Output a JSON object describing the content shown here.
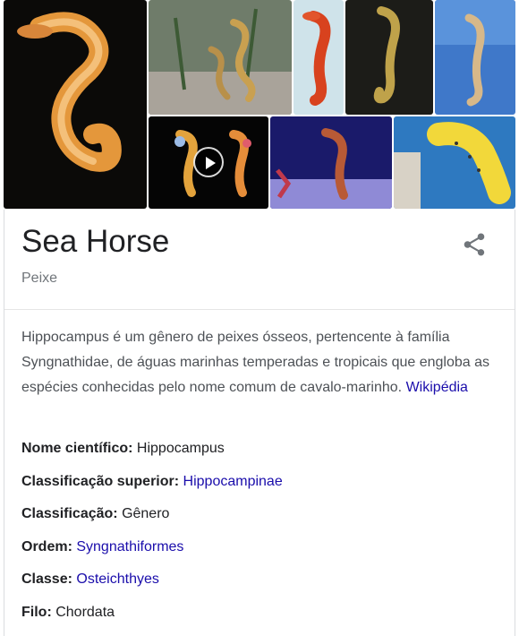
{
  "entity": {
    "title": "Sea Horse",
    "subtitle": "Peixe"
  },
  "description": {
    "text": "Hippocampus é um gênero de peixes ósseos, pertencente à família Syngnathidae, de águas marinhas temperadas e tropicais que engloba as espécies conhecidas pelo nome comum de cavalo-marinho.",
    "source_link": "Wikipédia"
  },
  "facts": [
    {
      "label": "Nome científico:",
      "value": "Hippocampus",
      "is_link": false
    },
    {
      "label": "Classificação superior:",
      "value": "Hippocampinae",
      "is_link": true
    },
    {
      "label": "Classificação:",
      "value": "Gênero",
      "is_link": false
    },
    {
      "label": "Ordem:",
      "value": "Syngnathiformes",
      "is_link": true
    },
    {
      "label": "Classe:",
      "value": "Osteichthyes",
      "is_link": true
    },
    {
      "label": "Filo:",
      "value": "Chordata",
      "is_link": false
    }
  ],
  "icons": {
    "share": "share-icon",
    "play": "play-icon"
  },
  "colors": {
    "link": "#1a0dab",
    "title": "#202124",
    "subtitle": "#70757a",
    "body": "#4d5156"
  }
}
